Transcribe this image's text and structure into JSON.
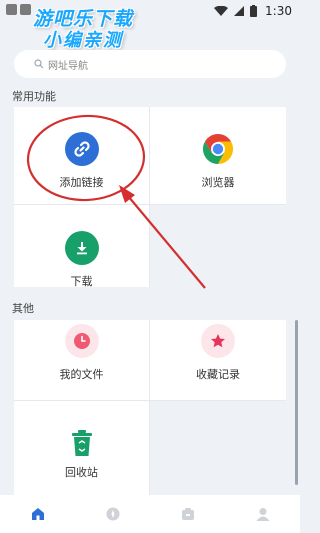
{
  "status_bar": {
    "time": "1:30"
  },
  "watermark": {
    "line1": "游吧乐下载",
    "line2": "小编亲测"
  },
  "search": {
    "placeholder": "网址导航"
  },
  "common": {
    "title": "常用功能",
    "items": [
      {
        "label": "添加链接",
        "icon": "link-icon"
      },
      {
        "label": "浏览器",
        "icon": "chrome-icon"
      },
      {
        "label": "下载",
        "icon": "download-icon"
      }
    ]
  },
  "other": {
    "title": "其他",
    "items": [
      {
        "label": "我的文件",
        "icon": "clock-icon"
      },
      {
        "label": "收藏记录",
        "icon": "star-icon"
      },
      {
        "label": "回收站",
        "icon": "recycle-bin-icon"
      }
    ]
  },
  "tabs": [
    {
      "icon": "home-icon",
      "active": true
    },
    {
      "icon": "compass-icon",
      "active": false
    },
    {
      "icon": "box-icon",
      "active": false
    },
    {
      "icon": "user-icon",
      "active": false
    }
  ],
  "colors": {
    "accent": "#2d6fd6",
    "annotation": "#d32f2f",
    "download_green": "#18a06a"
  }
}
